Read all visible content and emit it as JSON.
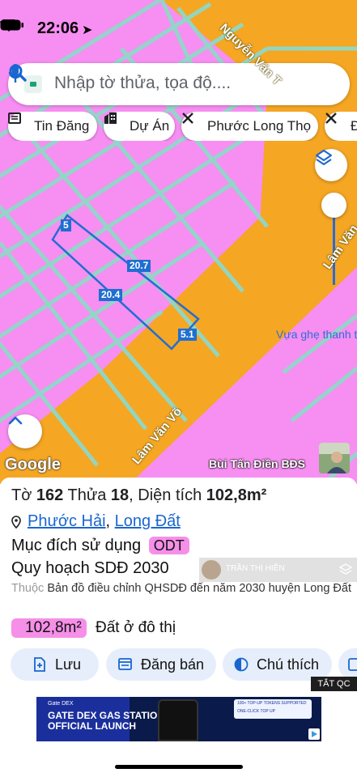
{
  "status_bar": {
    "time": "22:06"
  },
  "search": {
    "placeholder": "Nhập tờ thửa, tọa độ...."
  },
  "chips": [
    {
      "label": "Tin Đăng",
      "icon": "newspaper-icon"
    },
    {
      "label": "Dự Án",
      "icon": "buildings-icon"
    },
    {
      "label": "Phước Long Thọ",
      "icon": "tools-cross-icon"
    },
    {
      "label": "Đ",
      "icon": "tools-cross-icon"
    }
  ],
  "map": {
    "road_labels": [
      "Nguyễn Văn T",
      "Lâm Văn",
      "Lâm Văn Võ"
    ],
    "plot_dims": [
      "5",
      "20.7",
      "20.4",
      "5.1"
    ],
    "poi": "Vựa ghẹ thanh t",
    "attribution": "Google",
    "owner": "Bùi Tấn Điền BĐS"
  },
  "parcel": {
    "to_label": "Tờ",
    "to_value": "162",
    "thua_label": "Thửa",
    "thua_value": "18",
    "area_label": "Diện tích",
    "area_value": "102,8m²",
    "ward": "Phước Hải",
    "district": "Long Đất",
    "purpose_label": "Mục đích sử dụng",
    "purpose_code": "ODT",
    "plan_label": "Quy hoạch SDĐ 2030",
    "belongs_lead": "Thuộc",
    "belongs_text": "Bản đồ điều chỉnh QHSDĐ đến năm 2030 huyện Long Đất",
    "land_area": "102,8m²",
    "land_type": "Đất ở đô thị"
  },
  "actions": [
    {
      "label": "Lưu",
      "icon": "save-add-icon"
    },
    {
      "label": "Đăng bán",
      "icon": "listing-icon"
    },
    {
      "label": "Chú thích",
      "icon": "contrast-icon"
    },
    {
      "label": "",
      "icon": "more-icon"
    }
  ],
  "watermark_name": "TRẦN THỊ HIỀN",
  "ad": {
    "close_label": "TẮT QC",
    "brand": "Gate DEX",
    "headline_1": "GATE DEX GAS STATION",
    "headline_2": "OFFICIAL LAUNCH",
    "panel_1": "100+ TOP-UP TOKENS SUPPORTED",
    "panel_2": "ONE-CLICK TOP UP"
  },
  "colors": {
    "land_pink": "#f78ef2",
    "road_orange": "#f5a623",
    "grid_teal": "#8fd8c8",
    "plot_blue": "#1f6fd1",
    "link_blue": "#1a66d0",
    "badge_pink": "#f58fe8",
    "action_bg": "#e6eefb"
  }
}
